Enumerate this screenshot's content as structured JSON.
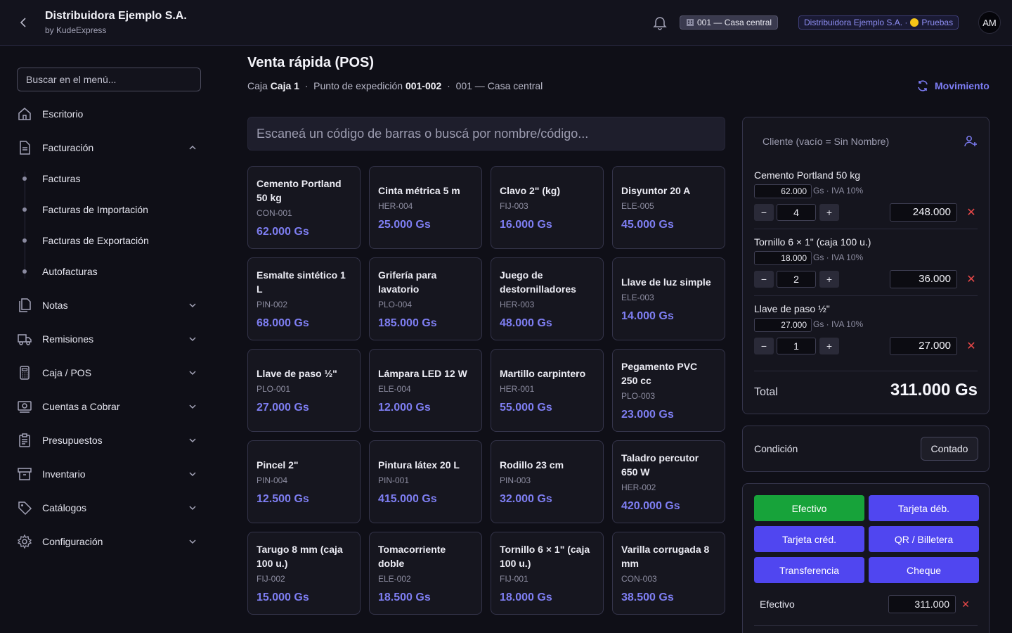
{
  "header": {
    "title": "Distribuidora Ejemplo S.A.",
    "subtitle": "by KudeExpress",
    "branch": "001 — Casa central",
    "company": "Distribuidora Ejemplo S.A. ·",
    "environment": "Pruebas",
    "avatar": "AM"
  },
  "sidebar": {
    "search_placeholder": "Buscar en el menú...",
    "items": [
      {
        "label": "Escritorio"
      },
      {
        "label": "Facturación"
      },
      {
        "label": "Notas"
      },
      {
        "label": "Remisiones"
      },
      {
        "label": "Caja / POS"
      },
      {
        "label": "Cuentas a Cobrar"
      },
      {
        "label": "Presupuestos"
      },
      {
        "label": "Inventario"
      },
      {
        "label": "Catálogos"
      },
      {
        "label": "Configuración"
      }
    ],
    "subitems": [
      {
        "label": "Facturas"
      },
      {
        "label": "Facturas de Importación"
      },
      {
        "label": "Facturas de Exportación"
      },
      {
        "label": "Autofacturas"
      }
    ]
  },
  "main": {
    "title": "Venta rápida (POS)",
    "caja_label": "Caja",
    "caja_value": "Caja 1",
    "punto_label": "Punto de expedición",
    "punto_value": "001-002",
    "branch": "001 — Casa central",
    "movimiento": "Movimiento",
    "scan_placeholder": "Escaneá un código de barras o buscá por nombre/código..."
  },
  "products": [
    {
      "name": "Cemento Portland 50 kg",
      "code": "CON-001",
      "price": "62.000 Gs"
    },
    {
      "name": "Cinta métrica 5 m",
      "code": "HER-004",
      "price": "25.000 Gs"
    },
    {
      "name": "Clavo 2\" (kg)",
      "code": "FIJ-003",
      "price": "16.000 Gs"
    },
    {
      "name": "Disyuntor 20 A",
      "code": "ELE-005",
      "price": "45.000 Gs"
    },
    {
      "name": "Esmalte sintético 1 L",
      "code": "PIN-002",
      "price": "68.000 Gs"
    },
    {
      "name": "Grifería para lavatorio",
      "code": "PLO-004",
      "price": "185.000 Gs"
    },
    {
      "name": "Juego de destornilladores",
      "code": "HER-003",
      "price": "48.000 Gs"
    },
    {
      "name": "Llave de luz simple",
      "code": "ELE-003",
      "price": "14.000 Gs"
    },
    {
      "name": "Llave de paso ½\"",
      "code": "PLO-001",
      "price": "27.000 Gs"
    },
    {
      "name": "Lámpara LED 12 W",
      "code": "ELE-004",
      "price": "12.000 Gs"
    },
    {
      "name": "Martillo carpintero",
      "code": "HER-001",
      "price": "55.000 Gs"
    },
    {
      "name": "Pegamento PVC 250 cc",
      "code": "PLO-003",
      "price": "23.000 Gs"
    },
    {
      "name": "Pincel 2\"",
      "code": "PIN-004",
      "price": "12.500 Gs"
    },
    {
      "name": "Pintura látex 20 L",
      "code": "PIN-001",
      "price": "415.000 Gs"
    },
    {
      "name": "Rodillo 23 cm",
      "code": "PIN-003",
      "price": "32.000 Gs"
    },
    {
      "name": "Taladro percutor 650 W",
      "code": "HER-002",
      "price": "420.000 Gs"
    },
    {
      "name": "Tarugo 8 mm (caja 100 u.)",
      "code": "FIJ-002",
      "price": "15.000 Gs"
    },
    {
      "name": "Tomacorriente doble",
      "code": "ELE-002",
      "price": "18.500 Gs"
    },
    {
      "name": "Tornillo 6 × 1\" (caja 100 u.)",
      "code": "FIJ-001",
      "price": "18.000 Gs"
    },
    {
      "name": "Varilla corrugada 8 mm",
      "code": "CON-003",
      "price": "38.500 Gs"
    }
  ],
  "cart": {
    "client_placeholder": "Cliente (vacío = Sin Nombre)",
    "items": [
      {
        "name": "Cemento Portland 50 kg",
        "unit_price": "62.000",
        "meta": "Gs · IVA 10%",
        "qty": "4",
        "total": "248.000"
      },
      {
        "name": "Tornillo 6 × 1\" (caja 100 u.)",
        "unit_price": "18.000",
        "meta": "Gs · IVA 10%",
        "qty": "2",
        "total": "36.000"
      },
      {
        "name": "Llave de paso ½\"",
        "unit_price": "27.000",
        "meta": "Gs · IVA 10%",
        "qty": "1",
        "total": "27.000"
      }
    ],
    "minus": "−",
    "plus": "+",
    "remove": "✕",
    "total_label": "Total",
    "total_value": "311.000 Gs"
  },
  "condition": {
    "label": "Condición",
    "value": "Contado"
  },
  "payment": {
    "methods": [
      {
        "label": "Efectivo",
        "active": true
      },
      {
        "label": "Tarjeta déb."
      },
      {
        "label": "Tarjeta créd."
      },
      {
        "label": "QR / Billetera"
      },
      {
        "label": "Transferencia"
      },
      {
        "label": "Cheque"
      }
    ],
    "line_label": "Efectivo",
    "line_amount": "311.000",
    "remove": "✕"
  },
  "colors": {
    "accent": "#5046f0",
    "price": "#7e7ef2",
    "success": "#17a33a",
    "danger": "#e84848"
  }
}
